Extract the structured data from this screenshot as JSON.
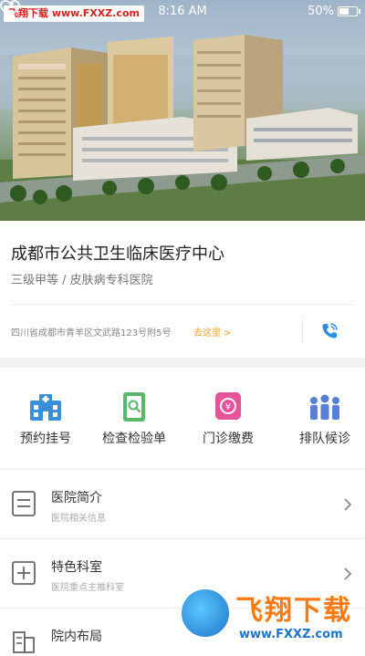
{
  "status_bar": {
    "watermark_text": "飞翔下载 www.FXXZ.com",
    "time": "8:16 AM",
    "battery": "50%",
    "battery_level": 0.5
  },
  "hospital": {
    "name": "成都市公共卫生临床医疗中心",
    "level": "三级甲等 / 皮肤病专科医院",
    "address": "四川省成都市青羊区文武路123号附5号",
    "goto_label": "去这里 >"
  },
  "services": [
    {
      "label": "预约挂号",
      "icon": "hospital-icon",
      "color": "#3a8fd9"
    },
    {
      "label": "检查检验单",
      "icon": "report-icon",
      "color": "#5bb86a"
    },
    {
      "label": "门诊缴费",
      "icon": "payment-icon",
      "color": "#e6539a"
    },
    {
      "label": "排队候诊",
      "icon": "queue-icon",
      "color": "#5a7fd6"
    }
  ],
  "menu": [
    {
      "title": "医院简介",
      "subtitle": "医院相关信息",
      "icon": "document-icon"
    },
    {
      "title": "特色科室",
      "subtitle": "医院重点主推科室",
      "icon": "department-icon"
    },
    {
      "title": "院内布局",
      "subtitle": "",
      "icon": "building-icon"
    }
  ],
  "watermark": {
    "title": "飞翔下载",
    "url": "www.FXXZ.com"
  }
}
